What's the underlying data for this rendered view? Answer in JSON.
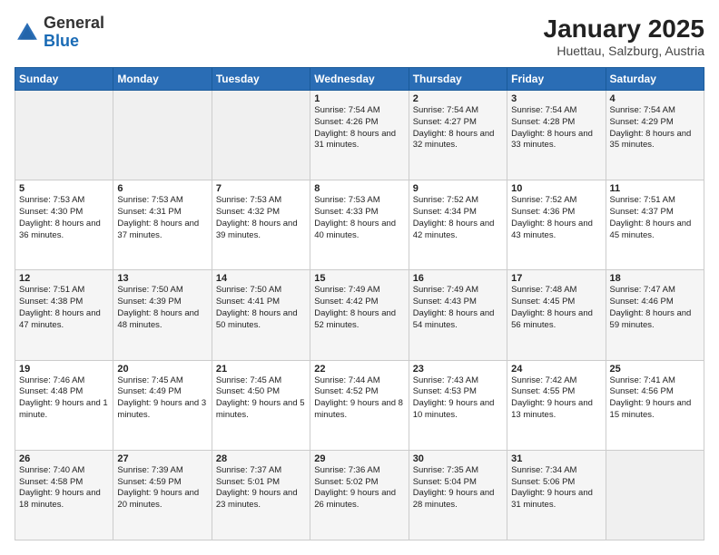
{
  "header": {
    "logo_general": "General",
    "logo_blue": "Blue",
    "month_title": "January 2025",
    "location": "Huettau, Salzburg, Austria"
  },
  "weekdays": [
    "Sunday",
    "Monday",
    "Tuesday",
    "Wednesday",
    "Thursday",
    "Friday",
    "Saturday"
  ],
  "weeks": [
    [
      {
        "day": "",
        "content": ""
      },
      {
        "day": "",
        "content": ""
      },
      {
        "day": "",
        "content": ""
      },
      {
        "day": "1",
        "content": "Sunrise: 7:54 AM\nSunset: 4:26 PM\nDaylight: 8 hours and 31 minutes."
      },
      {
        "day": "2",
        "content": "Sunrise: 7:54 AM\nSunset: 4:27 PM\nDaylight: 8 hours and 32 minutes."
      },
      {
        "day": "3",
        "content": "Sunrise: 7:54 AM\nSunset: 4:28 PM\nDaylight: 8 hours and 33 minutes."
      },
      {
        "day": "4",
        "content": "Sunrise: 7:54 AM\nSunset: 4:29 PM\nDaylight: 8 hours and 35 minutes."
      }
    ],
    [
      {
        "day": "5",
        "content": "Sunrise: 7:53 AM\nSunset: 4:30 PM\nDaylight: 8 hours and 36 minutes."
      },
      {
        "day": "6",
        "content": "Sunrise: 7:53 AM\nSunset: 4:31 PM\nDaylight: 8 hours and 37 minutes."
      },
      {
        "day": "7",
        "content": "Sunrise: 7:53 AM\nSunset: 4:32 PM\nDaylight: 8 hours and 39 minutes."
      },
      {
        "day": "8",
        "content": "Sunrise: 7:53 AM\nSunset: 4:33 PM\nDaylight: 8 hours and 40 minutes."
      },
      {
        "day": "9",
        "content": "Sunrise: 7:52 AM\nSunset: 4:34 PM\nDaylight: 8 hours and 42 minutes."
      },
      {
        "day": "10",
        "content": "Sunrise: 7:52 AM\nSunset: 4:36 PM\nDaylight: 8 hours and 43 minutes."
      },
      {
        "day": "11",
        "content": "Sunrise: 7:51 AM\nSunset: 4:37 PM\nDaylight: 8 hours and 45 minutes."
      }
    ],
    [
      {
        "day": "12",
        "content": "Sunrise: 7:51 AM\nSunset: 4:38 PM\nDaylight: 8 hours and 47 minutes."
      },
      {
        "day": "13",
        "content": "Sunrise: 7:50 AM\nSunset: 4:39 PM\nDaylight: 8 hours and 48 minutes."
      },
      {
        "day": "14",
        "content": "Sunrise: 7:50 AM\nSunset: 4:41 PM\nDaylight: 8 hours and 50 minutes."
      },
      {
        "day": "15",
        "content": "Sunrise: 7:49 AM\nSunset: 4:42 PM\nDaylight: 8 hours and 52 minutes."
      },
      {
        "day": "16",
        "content": "Sunrise: 7:49 AM\nSunset: 4:43 PM\nDaylight: 8 hours and 54 minutes."
      },
      {
        "day": "17",
        "content": "Sunrise: 7:48 AM\nSunset: 4:45 PM\nDaylight: 8 hours and 56 minutes."
      },
      {
        "day": "18",
        "content": "Sunrise: 7:47 AM\nSunset: 4:46 PM\nDaylight: 8 hours and 59 minutes."
      }
    ],
    [
      {
        "day": "19",
        "content": "Sunrise: 7:46 AM\nSunset: 4:48 PM\nDaylight: 9 hours and 1 minute."
      },
      {
        "day": "20",
        "content": "Sunrise: 7:45 AM\nSunset: 4:49 PM\nDaylight: 9 hours and 3 minutes."
      },
      {
        "day": "21",
        "content": "Sunrise: 7:45 AM\nSunset: 4:50 PM\nDaylight: 9 hours and 5 minutes."
      },
      {
        "day": "22",
        "content": "Sunrise: 7:44 AM\nSunset: 4:52 PM\nDaylight: 9 hours and 8 minutes."
      },
      {
        "day": "23",
        "content": "Sunrise: 7:43 AM\nSunset: 4:53 PM\nDaylight: 9 hours and 10 minutes."
      },
      {
        "day": "24",
        "content": "Sunrise: 7:42 AM\nSunset: 4:55 PM\nDaylight: 9 hours and 13 minutes."
      },
      {
        "day": "25",
        "content": "Sunrise: 7:41 AM\nSunset: 4:56 PM\nDaylight: 9 hours and 15 minutes."
      }
    ],
    [
      {
        "day": "26",
        "content": "Sunrise: 7:40 AM\nSunset: 4:58 PM\nDaylight: 9 hours and 18 minutes."
      },
      {
        "day": "27",
        "content": "Sunrise: 7:39 AM\nSunset: 4:59 PM\nDaylight: 9 hours and 20 minutes."
      },
      {
        "day": "28",
        "content": "Sunrise: 7:37 AM\nSunset: 5:01 PM\nDaylight: 9 hours and 23 minutes."
      },
      {
        "day": "29",
        "content": "Sunrise: 7:36 AM\nSunset: 5:02 PM\nDaylight: 9 hours and 26 minutes."
      },
      {
        "day": "30",
        "content": "Sunrise: 7:35 AM\nSunset: 5:04 PM\nDaylight: 9 hours and 28 minutes."
      },
      {
        "day": "31",
        "content": "Sunrise: 7:34 AM\nSunset: 5:06 PM\nDaylight: 9 hours and 31 minutes."
      },
      {
        "day": "",
        "content": ""
      }
    ]
  ]
}
